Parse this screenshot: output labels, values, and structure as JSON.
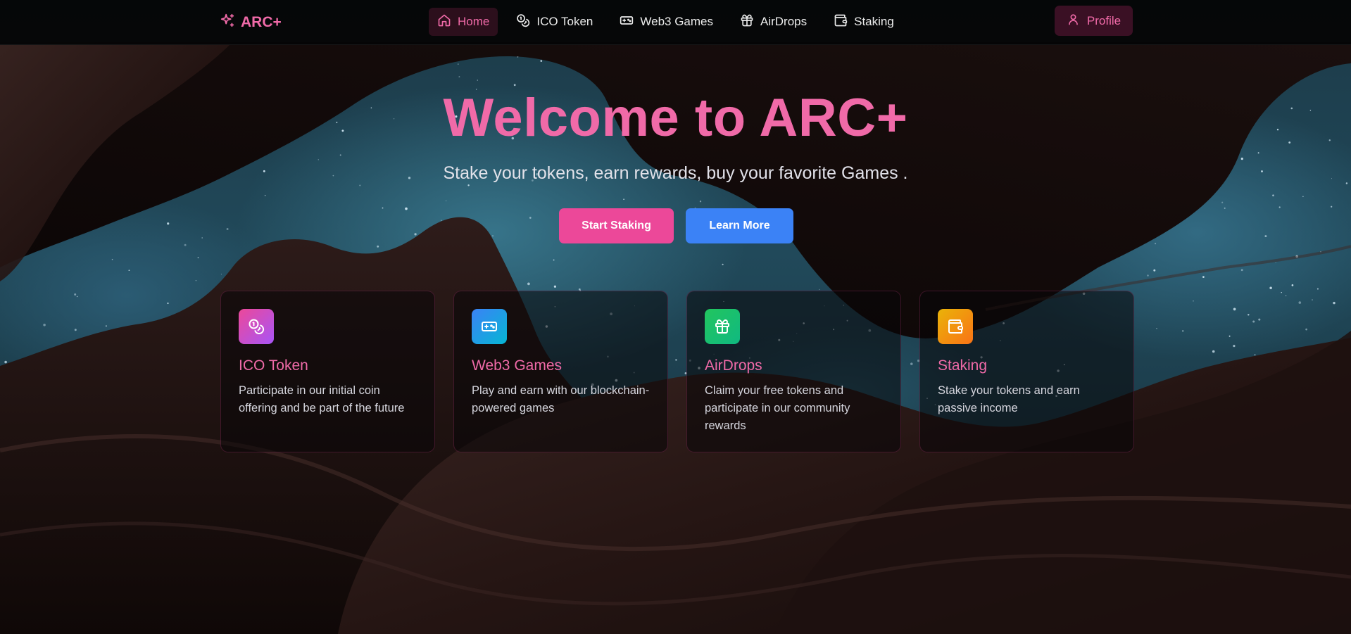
{
  "brand": {
    "name": "ARC+",
    "icon": "sparkles-icon"
  },
  "nav": {
    "items": [
      {
        "label": "Home",
        "icon": "home-icon",
        "active": true
      },
      {
        "label": "ICO Token",
        "icon": "coins-icon",
        "active": false
      },
      {
        "label": "Web3 Games",
        "icon": "gamepad-icon",
        "active": false
      },
      {
        "label": "AirDrops",
        "icon": "gift-icon",
        "active": false
      },
      {
        "label": "Staking",
        "icon": "wallet-icon",
        "active": false
      }
    ],
    "profile": {
      "label": "Profile",
      "icon": "user-icon"
    }
  },
  "hero": {
    "title": "Welcome to ARC+",
    "subtitle": "Stake your tokens, earn rewards, buy your favorite Games .",
    "primary_button": "Start Staking",
    "secondary_button": "Learn More"
  },
  "features": [
    {
      "title": "ICO Token",
      "description": "Participate in our initial coin offering and be part of the future",
      "icon": "coins-icon",
      "colors": [
        "#ec4899",
        "#a855f7"
      ]
    },
    {
      "title": "Web3 Games",
      "description": "Play and earn with our blockchain-powered games",
      "icon": "gamepad-icon",
      "colors": [
        "#3b82f6",
        "#06b6d4"
      ]
    },
    {
      "title": "AirDrops",
      "description": "Claim your free tokens and participate in our community rewards",
      "icon": "gift-icon",
      "colors": [
        "#22c55e",
        "#10b981"
      ]
    },
    {
      "title": "Staking",
      "description": "Stake your tokens and earn passive income",
      "icon": "wallet-icon",
      "colors": [
        "#eab308",
        "#f97316"
      ]
    }
  ],
  "theme": {
    "accent": "#f06aa8",
    "primary_button": "#ec4899",
    "secondary_button": "#3b82f6"
  }
}
